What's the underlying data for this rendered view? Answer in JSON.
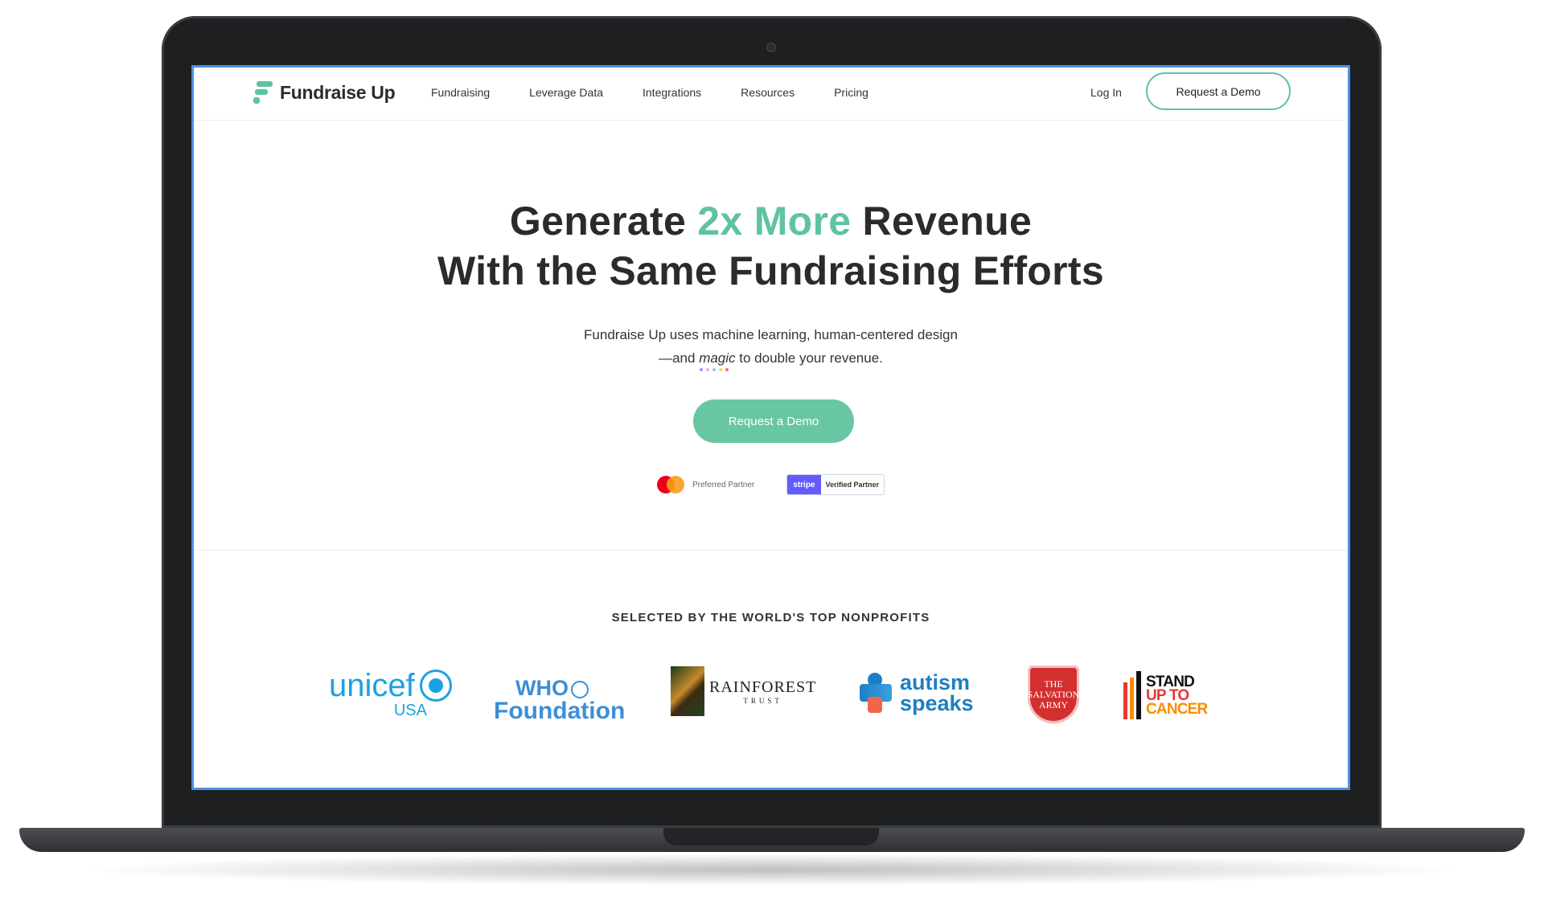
{
  "nav": {
    "brand": "Fundraise Up",
    "links": [
      "Fundraising",
      "Leverage Data",
      "Integrations",
      "Resources",
      "Pricing"
    ],
    "login": "Log In",
    "cta": "Request a Demo"
  },
  "hero": {
    "headline_pre": "Generate ",
    "headline_accent": "2x More",
    "headline_post": " Revenue",
    "headline_line2": "With the Same Fundraising Efforts",
    "sub_line1": "Fundraise Up uses machine learning, human-centered design",
    "sub_line2_pre": "—and ",
    "sub_magic": "magic",
    "sub_line2_post": " to double your revenue.",
    "cta": "Request a Demo",
    "partner_mastercard": "Preferred Partner",
    "partner_stripe_logo": "stripe",
    "partner_stripe": "Verified Partner"
  },
  "nonprofits": {
    "heading": "SELECTED BY THE WORLD'S TOP NONPROFITS",
    "logos": [
      {
        "name": "unicef",
        "line1": "unicef",
        "line2": "USA"
      },
      {
        "name": "who",
        "line1": "WHO",
        "line2": "Foundation"
      },
      {
        "name": "rainforest",
        "line1": "RAINFOREST",
        "line2": "TRUST"
      },
      {
        "name": "autism",
        "line1": "autism",
        "line2": "speaks"
      },
      {
        "name": "salvation",
        "line1": "THE SALVATION ARMY"
      },
      {
        "name": "stand-up",
        "line1": "STAND",
        "line2": "UP TO",
        "line3": "CANCER"
      }
    ]
  },
  "colors": {
    "accent": "#5fc3a0",
    "frame_border": "#4a90e2",
    "unicef": "#1ca2e1",
    "who": "#3b8fd6",
    "autism": "#1d7fc2",
    "salvation": "#d32f2f"
  }
}
